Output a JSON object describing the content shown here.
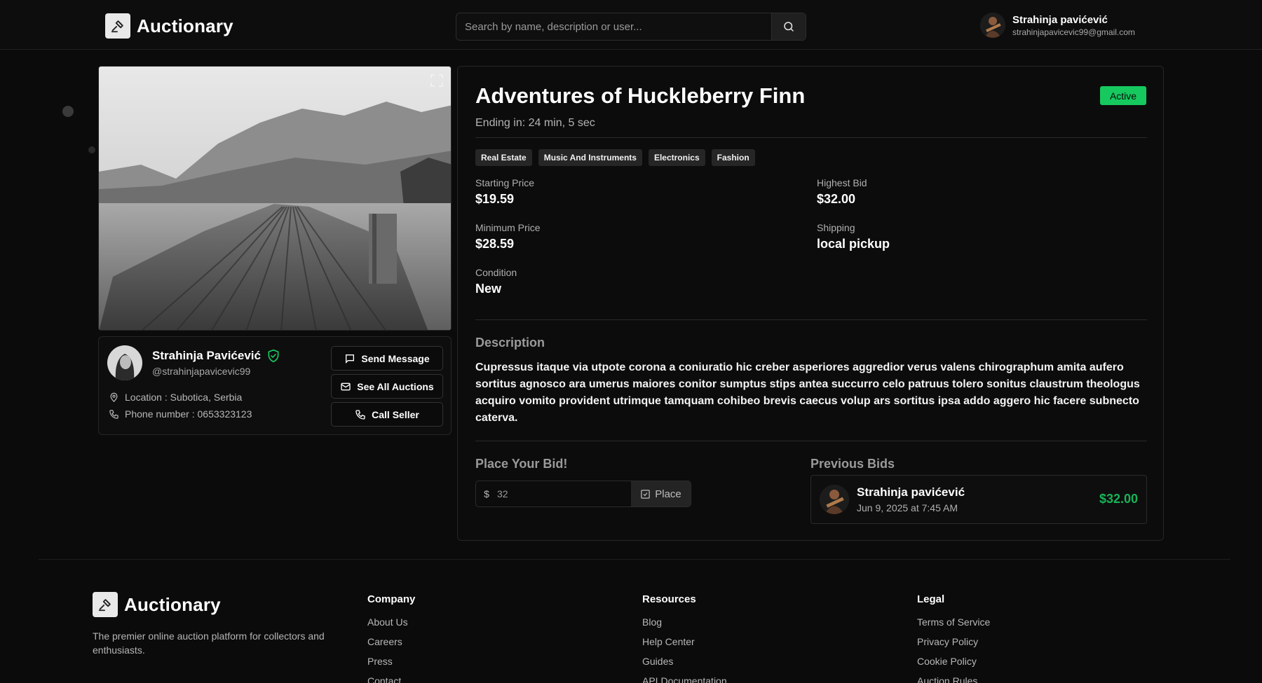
{
  "header": {
    "brand": "Auctionary",
    "search_placeholder": "Search by name, description or user...",
    "user_name": "Strahinja pavićević",
    "user_email": "strahinjapavicevic99@gmail.com"
  },
  "seller": {
    "name": "Strahinja Pavićević",
    "handle": "@strahinjapavicevic99",
    "location": "Location : Subotica, Serbia",
    "phone": "Phone number : 0653323123",
    "send_message": "Send Message",
    "see_all": "See All Auctions",
    "call": "Call Seller"
  },
  "auction": {
    "title": "Adventures of Huckleberry Finn",
    "ending": "Ending in: 24 min, 5 sec",
    "status": "Active",
    "tags": [
      "Real Estate",
      "Music And Instruments",
      "Electronics",
      "Fashion"
    ],
    "starting_price_label": "Starting Price",
    "starting_price": "$19.59",
    "highest_bid_label": "Highest Bid",
    "highest_bid": "$32.00",
    "minimum_price_label": "Minimum Price",
    "minimum_price": "$28.59",
    "shipping_label": "Shipping",
    "shipping": "local pickup",
    "condition_label": "Condition",
    "condition": "New",
    "description_title": "Description",
    "description": "Cupressus itaque via utpote corona a coniuratio hic creber asperiores aggredior verus valens chirographum amita aufero sortitus agnosco ara umerus maiores conitor sumptus stips antea succurro celo patruus tolero sonitus claustrum theologus acquiro vomito provident utrimque tamquam cohibeo brevis caecus volup ars sortitus ipsa addo aggero hic facere subnecto caterva."
  },
  "bid": {
    "title": "Place Your Bid!",
    "currency": "$",
    "value": "32",
    "place_label": "Place",
    "previous_title": "Previous Bids",
    "previous": [
      {
        "name": "Strahinja pavićević",
        "date": "Jun 9, 2025 at 7:45 AM",
        "amount": "$32.00"
      }
    ]
  },
  "footer": {
    "brand": "Auctionary",
    "tagline": "The premier online auction platform for collectors and enthusiasts.",
    "company_title": "Company",
    "company_links": [
      "About Us",
      "Careers",
      "Press",
      "Contact"
    ],
    "resources_title": "Resources",
    "resources_links": [
      "Blog",
      "Help Center",
      "Guides",
      "API Documentation"
    ],
    "legal_title": "Legal",
    "legal_links": [
      "Terms of Service",
      "Privacy Policy",
      "Cookie Policy",
      "Auction Rules"
    ]
  },
  "colors": {
    "accent_green": "#16c95f",
    "bid_amount": "#17b357",
    "background": "#0b0b0b"
  }
}
